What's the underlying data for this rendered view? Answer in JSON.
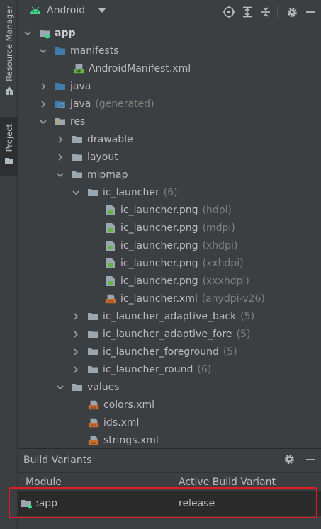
{
  "side_strip": {
    "resource_manager": "Resource Manager",
    "project": "Project"
  },
  "toolbar": {
    "view_mode": "Android"
  },
  "tree": {
    "app": "app",
    "manifests": "manifests",
    "android_manifest": "AndroidManifest.xml",
    "java": "java",
    "java_generated": "java",
    "java_generated_suffix": "(generated)",
    "res": "res",
    "drawable": "drawable",
    "layout": "layout",
    "mipmap": "mipmap",
    "ic_launcher": "ic_launcher",
    "ic_launcher_count": "(6)",
    "files": [
      {
        "name": "ic_launcher.png",
        "qualifier": "(hdpi)",
        "type": "png"
      },
      {
        "name": "ic_launcher.png",
        "qualifier": "(mdpi)",
        "type": "png"
      },
      {
        "name": "ic_launcher.png",
        "qualifier": "(xhdpi)",
        "type": "png"
      },
      {
        "name": "ic_launcher.png",
        "qualifier": "(xxhdpi)",
        "type": "png"
      },
      {
        "name": "ic_launcher.png",
        "qualifier": "(xxxhdpi)",
        "type": "png"
      },
      {
        "name": "ic_launcher.xml",
        "qualifier": "(anydpi-v26)",
        "type": "xml"
      }
    ],
    "adaptive_back": "ic_launcher_adaptive_back",
    "adaptive_back_count": "(5)",
    "adaptive_fore": "ic_launcher_adaptive_fore",
    "adaptive_fore_count": "(5)",
    "foreground": "ic_launcher_foreground",
    "foreground_count": "(5)",
    "round": "ic_launcher_round",
    "round_count": "(6)",
    "values": "values",
    "values_files": [
      "colors.xml",
      "ids.xml",
      "strings.xml"
    ]
  },
  "build_variants": {
    "title": "Build Variants",
    "col_module": "Module",
    "col_variant": "Active Build Variant",
    "module": ":app",
    "variant": "release"
  },
  "colors": {
    "android_green": "#3ddc84",
    "folder_blue": "#3f7cac",
    "folder_gray": "#9aa7b0",
    "xml_orange": "#cc6d30",
    "highlight_red": "#e01b24"
  }
}
